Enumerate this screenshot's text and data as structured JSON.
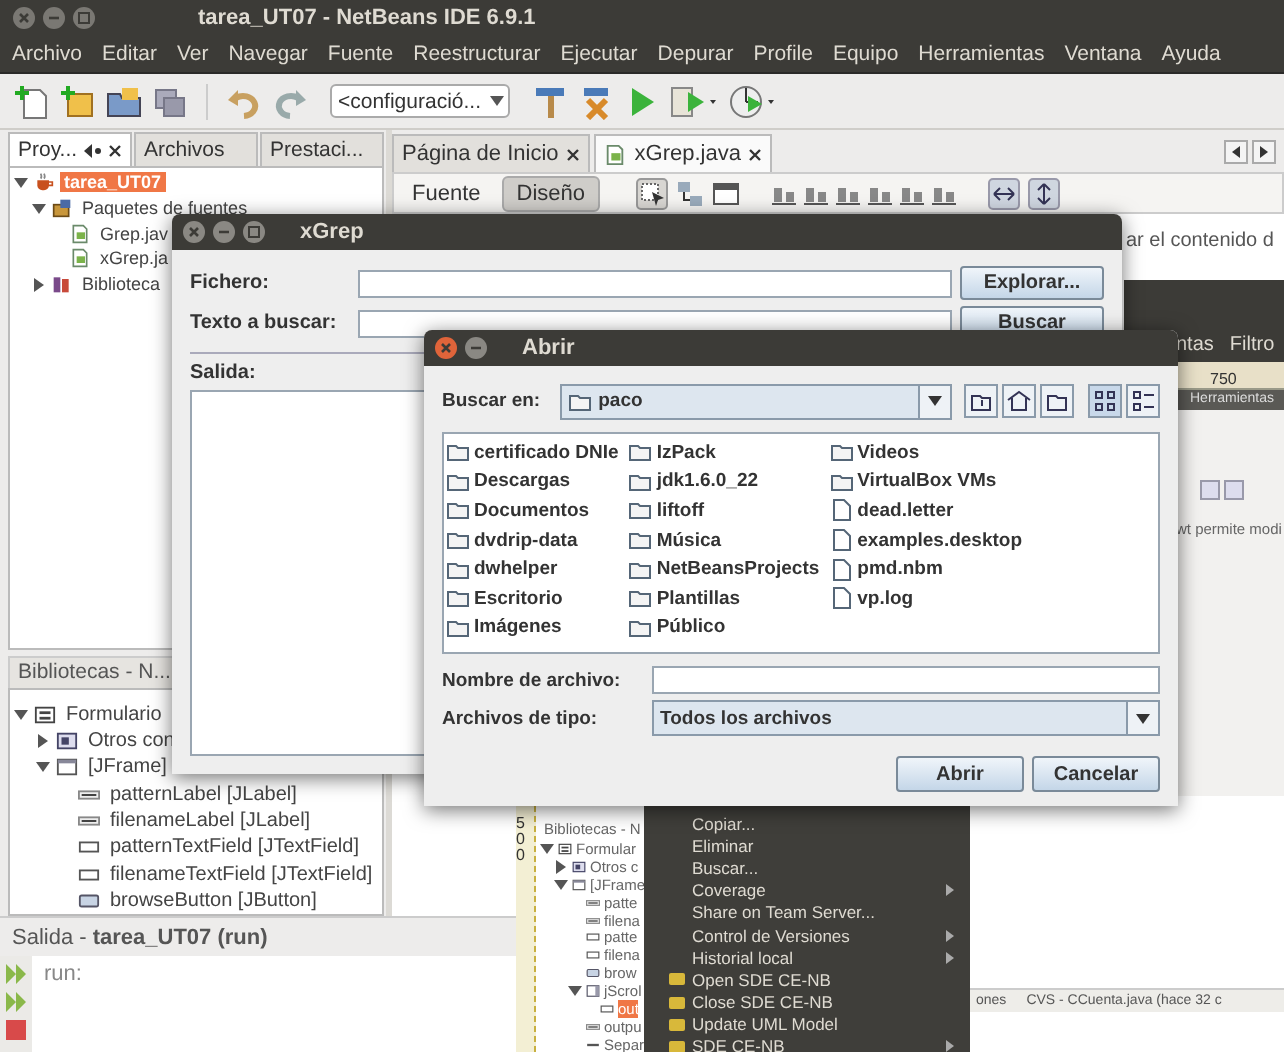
{
  "window": {
    "title": "tarea_UT07 - NetBeans IDE 6.9.1"
  },
  "menu_bar": [
    "Archivo",
    "Editar",
    "Ver",
    "Navegar",
    "Fuente",
    "Reestructurar",
    "Ejecutar",
    "Depurar",
    "Profile",
    "Equipo",
    "Herramientas",
    "Ventana",
    "Ayuda"
  ],
  "toolbar": {
    "configuration": "<configuració..."
  },
  "projects_panel": {
    "tabs": [
      {
        "label": "Proy...",
        "selected": true
      },
      {
        "label": "Archivos",
        "selected": false
      },
      {
        "label": "Prestaci...",
        "selected": false
      }
    ],
    "tree": [
      {
        "label": "tarea_UT07",
        "kind": "project",
        "selected": true,
        "expanded": true,
        "children": [
          {
            "label": "Paquetes de fuentes",
            "kind": "packages",
            "selected": false,
            "expanded": true,
            "children": [
              {
                "label": "Grep.jav",
                "kind": "java",
                "selected": false
              },
              {
                "label": "xGrep.ja",
                "kind": "java",
                "selected": false
              }
            ]
          },
          {
            "label": "Biblioteca",
            "kind": "library",
            "selected": false,
            "expanded": false
          }
        ]
      }
    ]
  },
  "navigator_panel": {
    "title": "Bibliotecas - N...",
    "tree": [
      {
        "label": "Formulario",
        "kind": "form",
        "selected": false,
        "expanded": true,
        "children": [
          {
            "label": "Otros con",
            "kind": "group",
            "selected": false,
            "expanded": false
          },
          {
            "label": "[JFrame]",
            "kind": "frame",
            "selected": false,
            "expanded": true,
            "children": [
              {
                "label": "patternLabel [JLabel]",
                "kind": "label",
                "selected": false
              },
              {
                "label": "filenameLabel [JLabel]",
                "kind": "label",
                "selected": false
              },
              {
                "label": "patternTextField [JTextField]",
                "kind": "textfield",
                "selected": false
              },
              {
                "label": "filenameTextField [JTextField]",
                "kind": "textfield",
                "selected": false
              },
              {
                "label": "browseButton [JButton]",
                "kind": "button",
                "selected": false
              }
            ]
          }
        ]
      }
    ]
  },
  "editor": {
    "tabs": [
      {
        "label": "Página de Inicio",
        "selected": false
      },
      {
        "label": "xGrep.java",
        "selected": true
      }
    ],
    "views": [
      {
        "label": "Fuente",
        "selected": false
      },
      {
        "label": "Diseño",
        "selected": true
      }
    ],
    "canvas_text": "ar el contenido d"
  },
  "output_panel": {
    "title": "Salida - **tarea_UT07 (run)**",
    "lines": [
      "run:"
    ]
  },
  "designer_preview_top": {
    "menu": [
      "ntas",
      "Filtro"
    ],
    "ruler_label": "750",
    "palette_title": "Herramientas",
    "text": "wt permite modi"
  },
  "designer_preview_bottom": {
    "ruler_label": "500",
    "panel_title": "Bibliotecas - N",
    "tree": [
      {
        "label": "Formular",
        "kind": "form",
        "selected": false,
        "expanded": true,
        "children": [
          {
            "label": "Otros c",
            "kind": "group",
            "selected": false,
            "expanded": false
          },
          {
            "label": "[JFrame",
            "kind": "frame",
            "selected": false,
            "expanded": true,
            "children": [
              {
                "label": "patte",
                "kind": "label",
                "selected": false
              },
              {
                "label": "filena",
                "kind": "label",
                "selected": false
              },
              {
                "label": "patte",
                "kind": "textfield",
                "selected": false
              },
              {
                "label": "filena",
                "kind": "textfield",
                "selected": false
              },
              {
                "label": "brow",
                "kind": "button",
                "selected": false
              },
              {
                "label": "jScrol",
                "kind": "scroll",
                "selected": false,
                "expanded": true,
                "children": [
                  {
                    "label": "out",
                    "kind": "textfield",
                    "selected": true
                  }
                ]
              },
              {
                "label": "outpu",
                "kind": "label",
                "selected": false
              },
              {
                "label": "Separ",
                "kind": "separator",
                "selected": false
              }
            ]
          }
        ]
      }
    ],
    "context_menu": [
      {
        "label": "Copiar...",
        "kind": "plain",
        "submenu": false
      },
      {
        "label": "Eliminar",
        "kind": "plain",
        "submenu": false
      },
      {
        "label": "Buscar...",
        "kind": "plain",
        "submenu": false
      },
      {
        "label": "Coverage",
        "kind": "plain",
        "submenu": true
      },
      {
        "label": "Share on Team Server...",
        "kind": "plain",
        "submenu": false
      },
      {
        "label": "Control de Versiones",
        "kind": "plain",
        "submenu": true
      },
      {
        "label": "Historial local",
        "kind": "plain",
        "submenu": true
      },
      {
        "label": "Open SDE CE-NB",
        "kind": "icon",
        "submenu": false
      },
      {
        "label": "Close SDE CE-NB",
        "kind": "icon",
        "submenu": false
      },
      {
        "label": "Update UML Model",
        "kind": "icon",
        "submenu": false
      },
      {
        "label": "SDE CE-NB",
        "kind": "icon",
        "submenu": true
      }
    ],
    "status_text": "ones",
    "status_vcs": "CVS - CCuenta.java (hace 32 c"
  },
  "xgrep_window": {
    "title": "xGrep",
    "fields": [
      {
        "label": "Fichero:",
        "button": "Explorar..."
      },
      {
        "label": "Texto a buscar:",
        "button": "Buscar"
      }
    ],
    "output_label": "Salida:"
  },
  "open_dialog": {
    "title": "Abrir",
    "look_in": {
      "label": "Buscar en:",
      "value": "paco"
    },
    "view_modes": [
      {
        "kind": "list",
        "selected": true
      },
      {
        "kind": "details",
        "selected": false
      }
    ],
    "files": [
      {
        "name": "certificado DNIe",
        "kind": "folder"
      },
      {
        "name": "Descargas",
        "kind": "folder"
      },
      {
        "name": "Documentos",
        "kind": "folder"
      },
      {
        "name": "dvdrip-data",
        "kind": "folder"
      },
      {
        "name": "dwhelper",
        "kind": "folder"
      },
      {
        "name": "Escritorio",
        "kind": "folder"
      },
      {
        "name": "Imágenes",
        "kind": "folder"
      },
      {
        "name": "IzPack",
        "kind": "folder"
      },
      {
        "name": "jdk1.6.0_22",
        "kind": "folder"
      },
      {
        "name": "liftoff",
        "kind": "folder"
      },
      {
        "name": "Música",
        "kind": "folder"
      },
      {
        "name": "NetBeansProjects",
        "kind": "folder"
      },
      {
        "name": "Plantillas",
        "kind": "folder"
      },
      {
        "name": "Público",
        "kind": "folder"
      },
      {
        "name": "Videos",
        "kind": "folder"
      },
      {
        "name": "VirtualBox VMs",
        "kind": "folder"
      },
      {
        "name": "dead.letter",
        "kind": "file"
      },
      {
        "name": "examples.desktop",
        "kind": "file"
      },
      {
        "name": "pmd.nbm",
        "kind": "file"
      },
      {
        "name": "vp.log",
        "kind": "file"
      }
    ],
    "file_name": {
      "label": "Nombre de archivo:"
    },
    "file_type": {
      "label": "Archivos de tipo:",
      "value": "Todos los archivos"
    },
    "buttons": [
      "Abrir",
      "Cancelar"
    ]
  }
}
